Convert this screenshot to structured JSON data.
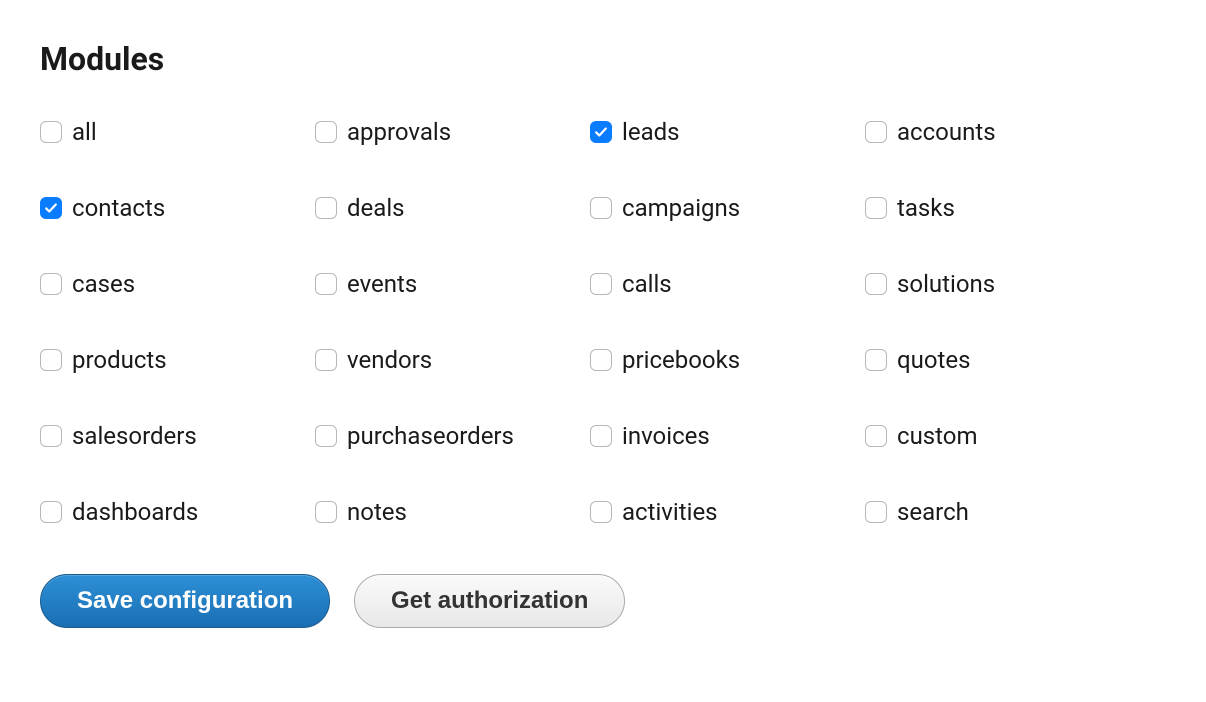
{
  "heading": "Modules",
  "modules": [
    {
      "key": "all",
      "label": "all",
      "checked": false
    },
    {
      "key": "approvals",
      "label": "approvals",
      "checked": false
    },
    {
      "key": "leads",
      "label": "leads",
      "checked": true
    },
    {
      "key": "accounts",
      "label": "accounts",
      "checked": false
    },
    {
      "key": "contacts",
      "label": "contacts",
      "checked": true
    },
    {
      "key": "deals",
      "label": "deals",
      "checked": false
    },
    {
      "key": "campaigns",
      "label": "campaigns",
      "checked": false
    },
    {
      "key": "tasks",
      "label": "tasks",
      "checked": false
    },
    {
      "key": "cases",
      "label": "cases",
      "checked": false
    },
    {
      "key": "events",
      "label": "events",
      "checked": false
    },
    {
      "key": "calls",
      "label": "calls",
      "checked": false
    },
    {
      "key": "solutions",
      "label": "solutions",
      "checked": false
    },
    {
      "key": "products",
      "label": "products",
      "checked": false
    },
    {
      "key": "vendors",
      "label": "vendors",
      "checked": false
    },
    {
      "key": "pricebooks",
      "label": "pricebooks",
      "checked": false
    },
    {
      "key": "quotes",
      "label": "quotes",
      "checked": false
    },
    {
      "key": "salesorders",
      "label": "salesorders",
      "checked": false
    },
    {
      "key": "purchaseorders",
      "label": "purchaseorders",
      "checked": false
    },
    {
      "key": "invoices",
      "label": "invoices",
      "checked": false
    },
    {
      "key": "custom",
      "label": "custom",
      "checked": false
    },
    {
      "key": "dashboards",
      "label": "dashboards",
      "checked": false
    },
    {
      "key": "notes",
      "label": "notes",
      "checked": false
    },
    {
      "key": "activities",
      "label": "activities",
      "checked": false
    },
    {
      "key": "search",
      "label": "search",
      "checked": false
    }
  ],
  "buttons": {
    "save": "Save configuration",
    "authorize": "Get authorization"
  }
}
